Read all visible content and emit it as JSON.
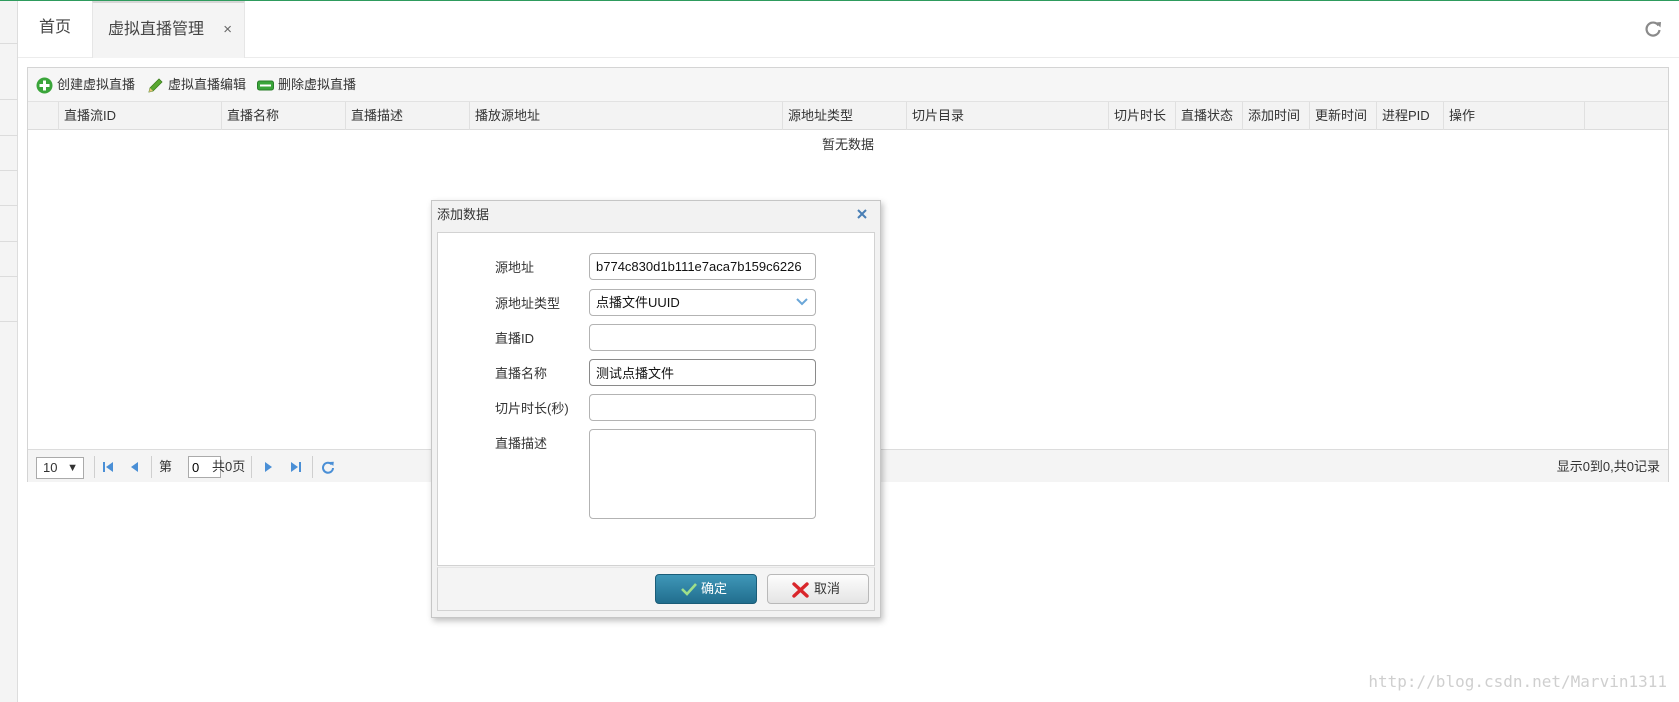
{
  "tabs": {
    "home": "首页",
    "active": "虚拟直播管理",
    "close_glyph": "×"
  },
  "toolbar": {
    "create": "创建虚拟直播",
    "edit": "虚拟直播编辑",
    "delete": "删除虚拟直播"
  },
  "table": {
    "columns": [
      "直播流ID",
      "直播名称",
      "直播描述",
      "播放源地址",
      "源地址类型",
      "切片目录",
      "切片时长",
      "直播状态",
      "添加时间",
      "更新时间",
      "进程PID",
      "操作"
    ],
    "empty_text": "暂无数据"
  },
  "pager": {
    "page_size": "10",
    "page_prefix": "第",
    "page_value": "0",
    "page_total": "共0页",
    "info": "显示0到0,共0记录"
  },
  "dialog": {
    "title": "添加数据",
    "fields": {
      "source_label": "源地址",
      "source_value": "b774c830d1b111e7aca7b159c6226",
      "source_type_label": "源地址类型",
      "source_type_value": "点播文件UUID",
      "live_id_label": "直播ID",
      "live_id_value": "",
      "live_name_label": "直播名称",
      "live_name_value": "测试点播文件",
      "slice_len_label": "切片时长(秒)",
      "slice_len_value": "",
      "desc_label": "直播描述",
      "desc_value": ""
    },
    "ok_label": "确定",
    "cancel_label": "取消"
  },
  "watermark": "http://blog.csdn.net/Marvin1311",
  "colors": {
    "accent_line": "#2e9b5d",
    "ok_button": "#2b7fa0",
    "add_icon": "#3aa53a",
    "cancel_icon": "#d9262b",
    "pager_icon": "#4a8fd6"
  },
  "icons": [
    "refresh-icon",
    "add-icon",
    "edit-icon",
    "delete-icon",
    "first-page-icon",
    "prev-page-icon",
    "next-page-icon",
    "last-page-icon",
    "reload-icon",
    "close-icon",
    "check-icon",
    "cancel-x-icon",
    "chevron-down-icon"
  ]
}
